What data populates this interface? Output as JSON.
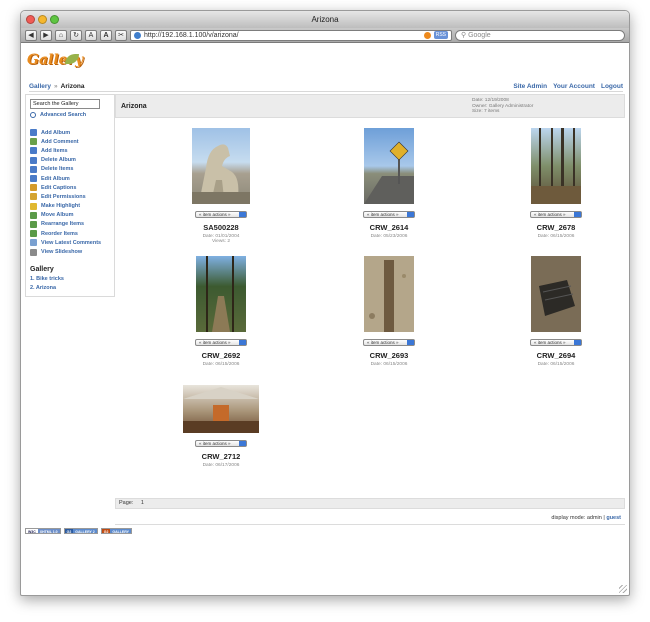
{
  "browser": {
    "title": "Arizona",
    "url": "http://192.168.1.100/v/arizona/",
    "rss_label": "RSS",
    "search_placeholder": "Google",
    "back": "◀",
    "forward": "▶",
    "font_small": "A",
    "font_large": "A"
  },
  "brand": {
    "logo_text": "Gallery"
  },
  "breadcrumb": {
    "root": "Gallery",
    "separator": "»",
    "current": "Arizona"
  },
  "top_links": [
    "Site Admin",
    "Your Account",
    "Logout"
  ],
  "sidebar": {
    "search_placeholder": "Search the Gallery",
    "advanced_search": "Advanced Search",
    "actions": [
      {
        "label": "Add Album",
        "color": "#4a7bc8"
      },
      {
        "label": "Add Comment",
        "color": "#6aa04a"
      },
      {
        "label": "Add Items",
        "color": "#4a7bc8"
      },
      {
        "label": "Delete Album",
        "color": "#4a7bc8"
      },
      {
        "label": "Delete Items",
        "color": "#4a7bc8"
      },
      {
        "label": "Edit Album",
        "color": "#4a7bc8"
      },
      {
        "label": "Edit Captions",
        "color": "#d49a2a"
      },
      {
        "label": "Edit Permissions",
        "color": "#d4a330"
      },
      {
        "label": "Make Highlight",
        "color": "#e0b830"
      },
      {
        "label": "Move Album",
        "color": "#5a9a48"
      },
      {
        "label": "Rearrange Items",
        "color": "#5a9a48"
      },
      {
        "label": "Reorder Items",
        "color": "#5a9a48"
      },
      {
        "label": "View Latest Comments",
        "color": "#7aa0d0"
      },
      {
        "label": "View Slideshow",
        "color": "#8a8a8a"
      }
    ],
    "gallery_title": "Gallery",
    "albums": [
      "1. Bike tricks",
      "2. Arizona"
    ]
  },
  "album": {
    "title": "Arizona",
    "date": "Date: 12/19/2008",
    "owner": "Owner: Gallery Administrator",
    "size": "Size: 7 items"
  },
  "items": [
    {
      "name": "SA500228",
      "date": "Date: 01/01/2004",
      "views": "Views: 2",
      "actions": "« item actions »"
    },
    {
      "name": "CRW_2614",
      "date": "Date: 05/23/2006",
      "actions": "« item actions »"
    },
    {
      "name": "CRW_2678",
      "date": "Date: 06/15/2006",
      "actions": "« item actions »"
    },
    {
      "name": "CRW_2692",
      "date": "Date: 06/15/2006",
      "actions": "« item actions »"
    },
    {
      "name": "CRW_2693",
      "date": "Date: 06/15/2006",
      "actions": "« item actions »"
    },
    {
      "name": "CRW_2694",
      "date": "Date: 06/15/2006",
      "actions": "« item actions »"
    },
    {
      "name": "CRW_2712",
      "date": "Date: 06/17/2006",
      "actions": "« item actions »"
    }
  ],
  "pager": {
    "label": "Page:",
    "page": "1"
  },
  "display_mode": {
    "text": "display mode: admin |",
    "guest": "guest"
  },
  "badges": [
    {
      "left": "W3C",
      "right": "XHTML 1.0",
      "color": "#6b8ec9"
    },
    {
      "left": "G2",
      "right": "GALLERY 2",
      "color": "#5b8acd"
    },
    {
      "left": "G2",
      "right": "GALLERY",
      "color": "#e07a2a"
    }
  ]
}
